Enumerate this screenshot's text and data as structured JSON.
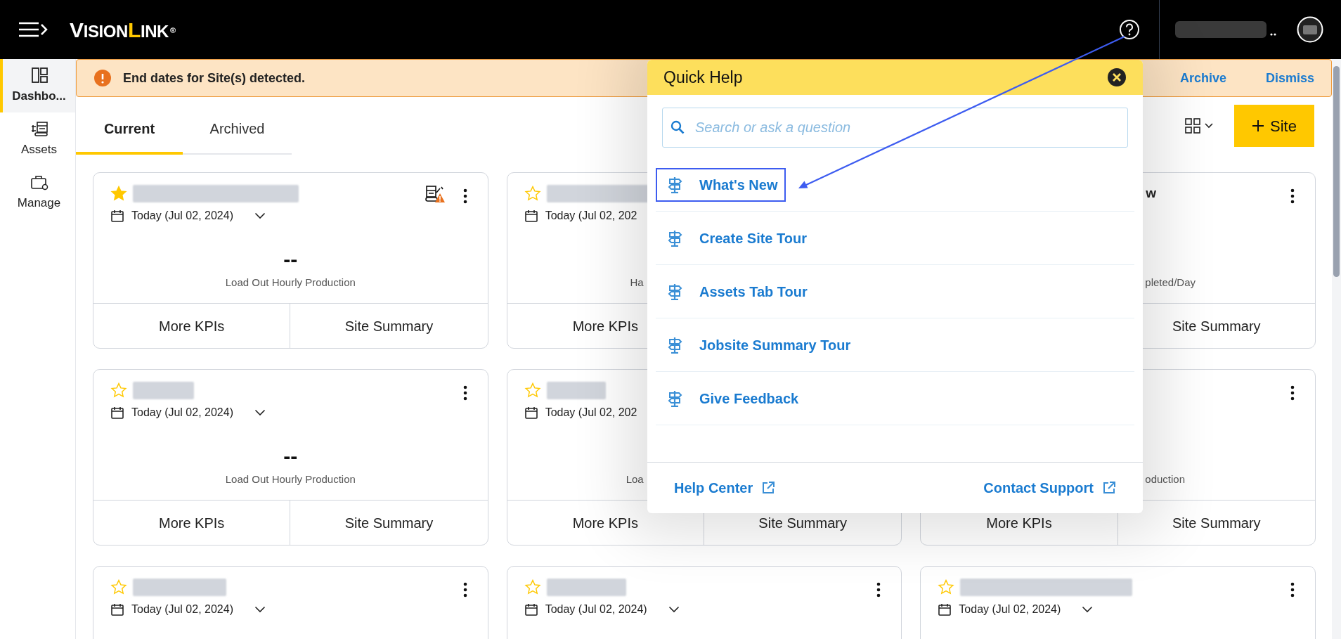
{
  "top_bar": {
    "logo": {
      "first": "V",
      "rest": "ISION",
      "highlight": "L",
      "end": "INK",
      "mark": "®"
    }
  },
  "sidebar": {
    "items": [
      {
        "label": "Dashbo...",
        "kind": "dashboard",
        "selected": true
      },
      {
        "label": "Assets",
        "kind": "assets",
        "selected": false
      },
      {
        "label": "Manage",
        "kind": "manage",
        "selected": false
      }
    ]
  },
  "banner": {
    "message": "End dates for Site(s) detected.",
    "actions": [
      "Archive",
      "Dismiss"
    ]
  },
  "tabs": [
    {
      "label": "Current",
      "selected": true
    },
    {
      "label": "Archived",
      "selected": false
    }
  ],
  "toolbar": {
    "add_button": "Site"
  },
  "cards": [
    {
      "starred": true,
      "blurred_title": true,
      "alert": true,
      "menu": true,
      "date": "Today (Jul 02, 2024)",
      "dropdown": true,
      "value": "--",
      "label": "Load Out Hourly Production",
      "more": "More KPIs",
      "summary": "Site Summary"
    },
    {
      "starred": false,
      "blurred_title": true,
      "date": "Today (Jul 02, 202",
      "label": "Ha",
      "more": "More KPIs"
    },
    {
      "title": "w",
      "menu": true,
      "label": "pleted/Day",
      "summary": "Site Summary"
    },
    {
      "starred": false,
      "blurred_title": true,
      "menu": true,
      "date": "Today (Jul 02, 2024)",
      "dropdown": true,
      "value": "--",
      "label": "Load Out Hourly Production",
      "more": "More KPIs",
      "summary": "Site Summary"
    },
    {
      "starred": false,
      "blurred_title": true,
      "date": "Today (Jul 02, 202",
      "label": "Loa",
      "more": "More KPIs",
      "summary": "Site Summary"
    },
    {
      "menu": true,
      "label": "oduction",
      "more": "More KPIs",
      "summary": "Site Summary"
    },
    {
      "starred": false,
      "blurred_title": true,
      "menu": true,
      "date": "Today (Jul 02, 2024)",
      "dropdown": true
    },
    {
      "starred": false,
      "blurred_title": true,
      "menu": true,
      "date": "Today (Jul 02, 2024)",
      "dropdown": true
    },
    {
      "starred": false,
      "blurred_title": true,
      "menu": true,
      "date": "Today (Jul 02, 2024)",
      "dropdown": true
    }
  ],
  "quick_help": {
    "title": "Quick Help",
    "search": {
      "placeholder": "Search or ask a question"
    },
    "items": [
      {
        "label": "What's New",
        "highlighted": true
      },
      {
        "label": "Create Site Tour",
        "highlighted": false
      },
      {
        "label": "Assets Tab Tour",
        "highlighted": false
      },
      {
        "label": "Jobsite Summary Tour",
        "highlighted": false
      },
      {
        "label": "Give Feedback",
        "highlighted": false
      }
    ],
    "footer_links": [
      "Help Center",
      "Contact Support"
    ]
  }
}
